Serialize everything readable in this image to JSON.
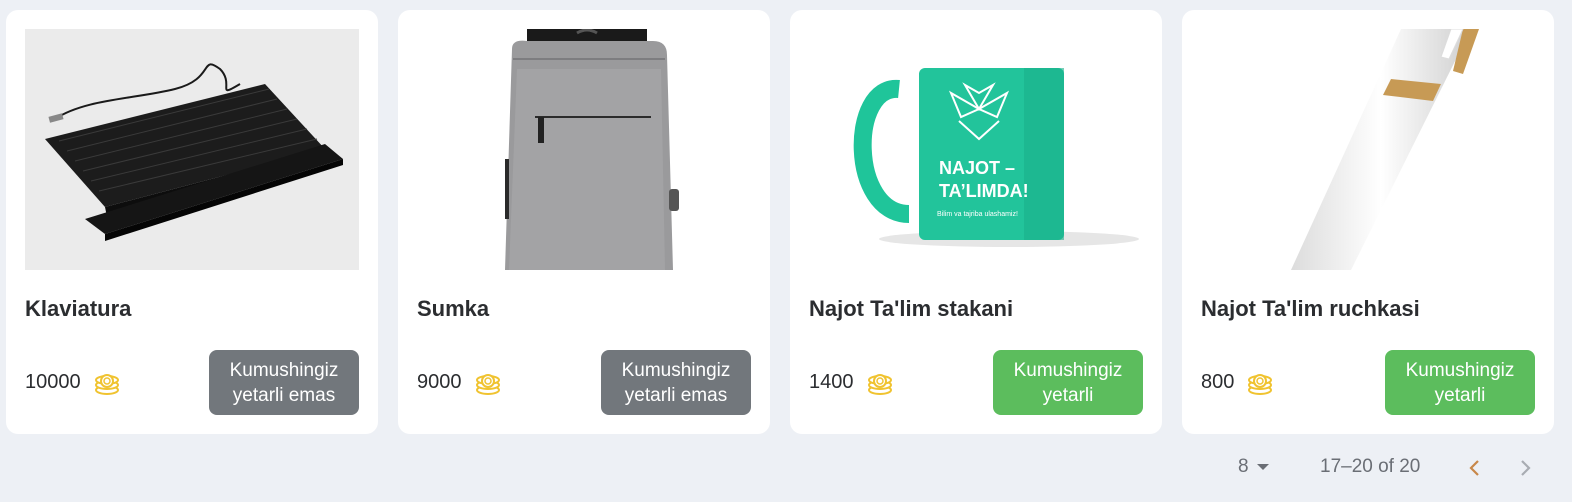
{
  "products": [
    {
      "name": "Klaviatura",
      "price": "10000",
      "button_label": "Kumushingiz yetarli emas",
      "affordable": false,
      "image": "keyboard"
    },
    {
      "name": "Sumka",
      "price": "9000",
      "button_label": "Kumushingiz yetarli emas",
      "affordable": false,
      "image": "backpack"
    },
    {
      "name": "Najot Ta'lim stakani",
      "price": "1400",
      "button_label": "Kumushingiz yetarli",
      "affordable": true,
      "image": "mug",
      "mug_text_line1": "NAJOT –",
      "mug_text_line2": "TA’LIMDA!",
      "mug_text_small": "Bilim va tajriba ulashamiz!"
    },
    {
      "name": "Najot Ta'lim ruchkasi",
      "price": "800",
      "button_label": "Kumushingiz yetarli",
      "affordable": true,
      "image": "pen"
    }
  ],
  "pagination": {
    "per_page": "8",
    "range": "17–20 of 20"
  },
  "colors": {
    "disabled_button": "#72777c",
    "enabled_button": "#5cbd5d",
    "coin": "#f0c330",
    "accent_prev": "#c8884a"
  },
  "icons": {
    "coin": "coin-stack-icon",
    "prev": "chevron-left-icon",
    "next": "chevron-right-icon",
    "per_page": "caret-down-icon"
  }
}
